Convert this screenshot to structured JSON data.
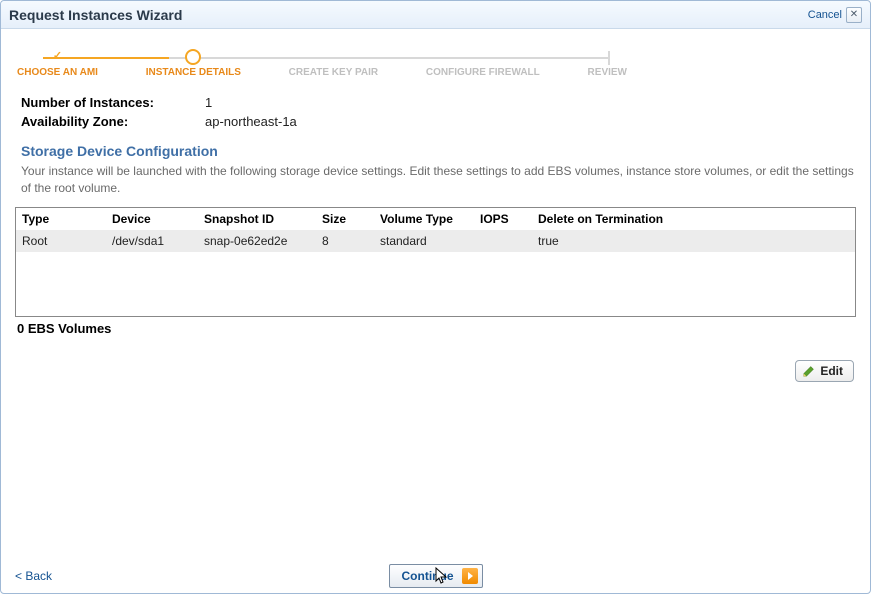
{
  "window": {
    "title": "Request Instances Wizard",
    "cancel": "Cancel"
  },
  "steps": [
    {
      "label": "CHOOSE AN AMI",
      "state": "done"
    },
    {
      "label": "INSTANCE DETAILS",
      "state": "active"
    },
    {
      "label": "CREATE KEY PAIR",
      "state": "pending"
    },
    {
      "label": "CONFIGURE FIREWALL",
      "state": "pending"
    },
    {
      "label": "REVIEW",
      "state": "pending"
    }
  ],
  "details": {
    "num_instances_label": "Number of Instances:",
    "num_instances_value": "1",
    "az_label": "Availability Zone:",
    "az_value": "ap-northeast-1a"
  },
  "storage": {
    "title": "Storage Device Configuration",
    "desc": "Your instance will be launched with the following storage device settings. Edit these settings to add EBS volumes, instance store volumes, or edit the settings of the root volume.",
    "columns": {
      "type": "Type",
      "device": "Device",
      "snapshot": "Snapshot ID",
      "size": "Size",
      "voltype": "Volume Type",
      "iops": "IOPS",
      "delete": "Delete on Termination"
    },
    "rows": [
      {
        "type": "Root",
        "device": "/dev/sda1",
        "snapshot": "snap-0e62ed2e",
        "size": "8",
        "voltype": "standard",
        "iops": "",
        "delete": "true"
      }
    ],
    "summary": "0 EBS Volumes",
    "edit_label": "Edit"
  },
  "footer": {
    "back": "< Back",
    "continue": "Continue"
  }
}
